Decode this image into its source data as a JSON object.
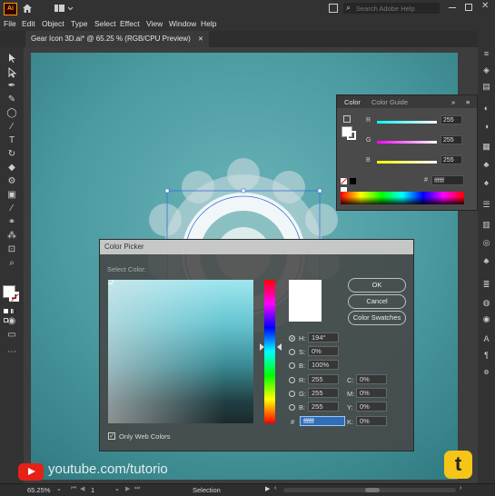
{
  "app": {
    "logo": "Ai",
    "logo_color": "#ff9a00"
  },
  "search": {
    "placeholder": "Search Adobe Help"
  },
  "menu": [
    "File",
    "Edit",
    "Object",
    "Type",
    "Select",
    "Effect",
    "View",
    "Window",
    "Help"
  ],
  "document_tab": {
    "title": "Gear Icon 3D.ai* @ 65.25 % (RGB/CPU Preview)",
    "close": "✕"
  },
  "color_panel": {
    "tabs": [
      "Color",
      "Color Guide"
    ],
    "channels": [
      {
        "label": "R",
        "value": "255"
      },
      {
        "label": "G",
        "value": "255"
      },
      {
        "label": "B",
        "value": "255"
      }
    ],
    "hex_symbol": "#",
    "hex": "ffffff"
  },
  "color_picker": {
    "title": "Color Picker",
    "select_label": "Select Color:",
    "buttons": {
      "ok": "OK",
      "cancel": "Cancel",
      "swatches": "Color Swatches"
    },
    "hsb": [
      {
        "label": "H:",
        "value": "194°",
        "selected": true
      },
      {
        "label": "S:",
        "value": "0%"
      },
      {
        "label": "B:",
        "value": "100%"
      }
    ],
    "rgb": [
      {
        "label": "R:",
        "value": "255"
      },
      {
        "label": "G:",
        "value": "255"
      },
      {
        "label": "B:",
        "value": "255"
      }
    ],
    "cmyk": [
      {
        "label": "C:",
        "value": "0%"
      },
      {
        "label": "M:",
        "value": "0%"
      },
      {
        "label": "Y:",
        "value": "0%"
      },
      {
        "label": "K:",
        "value": "0%"
      }
    ],
    "hex_symbol": "#",
    "hex": "ffffff",
    "only_web_colors": "Only Web Colors"
  },
  "status": {
    "zoom": "65.25%",
    "artboard": "1",
    "tool": "Selection"
  },
  "watermark": {
    "text": "youtube.com/tutorio",
    "badge": "t",
    "badge_color": "#f5c518"
  }
}
